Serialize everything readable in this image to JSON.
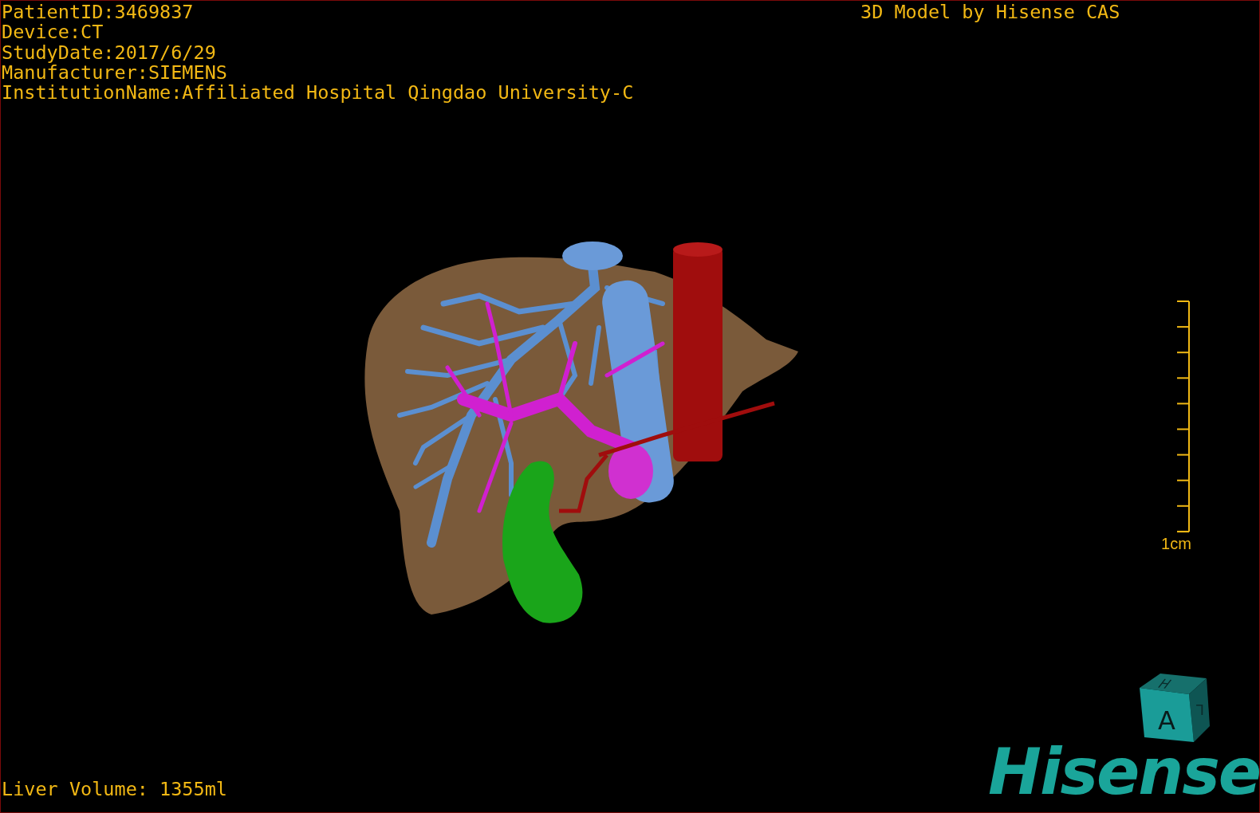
{
  "patient_info": [
    "PatientID:3469837",
    "Device:CT",
    "StudyDate:2017/6/29",
    "Manufacturer:SIEMENS",
    "InstitutionName:Affiliated Hospital Qingdao University-C"
  ],
  "model_credit": "3D Model by Hisense CAS",
  "scale_bar": {
    "label": "1cm"
  },
  "orientation_cube": {
    "front": "A",
    "top": "H",
    "side": "L"
  },
  "logo": "Hisense",
  "liver_volume": "Liver Volume: 1355ml"
}
